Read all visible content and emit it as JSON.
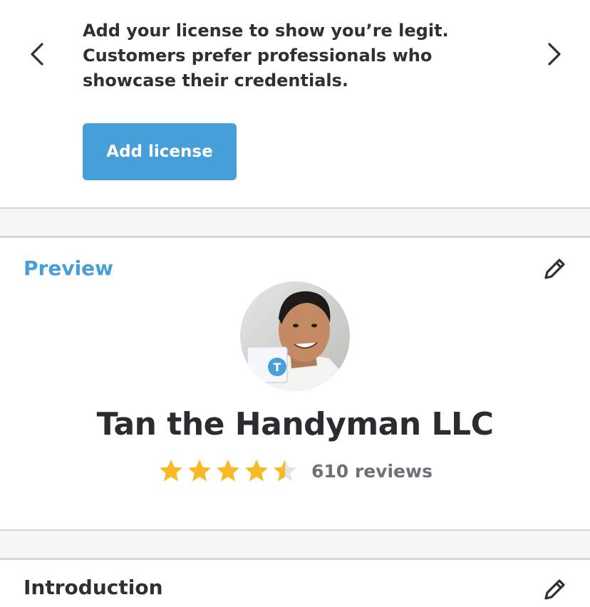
{
  "license_prompt": {
    "message": "Add your license to show you’re legit. Customers prefer professionals who showcase their credentials.",
    "button_label": "Add license"
  },
  "preview": {
    "section_title": "Preview",
    "business_name": "Tan the Handyman LLC",
    "rating": 4.5,
    "rating_max": 5,
    "reviews_label": "610 reviews"
  },
  "introduction": {
    "section_title": "Introduction"
  },
  "colors": {
    "accent": "#479fd9",
    "star": "#f7b928",
    "star_empty": "#e4e4e4",
    "text": "#2f3033",
    "muted": "#6f7175",
    "divider": "#d6d6d6"
  },
  "icons": {
    "prev": "chevron-left-icon",
    "next": "chevron-right-icon",
    "edit": "pencil-icon",
    "star": "star-icon"
  }
}
